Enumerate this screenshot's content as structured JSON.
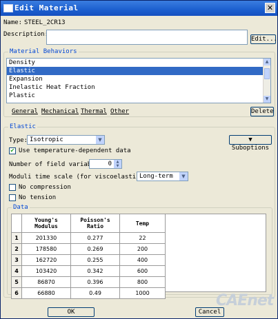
{
  "window": {
    "title": "Edit Material",
    "close_glyph": "✕"
  },
  "name": {
    "label": "Name:",
    "value": "STEEL_2CR13"
  },
  "description": {
    "label": "Description:",
    "value": "",
    "edit_label": "Edit..."
  },
  "behaviors": {
    "legend": "Material Behaviors",
    "items": [
      "Density",
      "Elastic",
      "Expansion",
      "Inelastic Heat Fraction",
      "Plastic"
    ],
    "selected": "Elastic",
    "menus": [
      "General",
      "Mechanical",
      "Thermal",
      "Other"
    ],
    "delete_label": "Delete"
  },
  "elastic": {
    "legend": "Elastic",
    "type_label": "Type:",
    "type_value": "Isotropic",
    "suboptions_label": "Suboptions",
    "use_temp_label": "Use temperature-dependent data",
    "use_temp_checked": true,
    "field_vars_label": "Number of field variables:",
    "field_vars_value": "0",
    "moduli_label": "Moduli time scale (for viscoelasticity):",
    "moduli_value": "Long-term",
    "no_compression_label": "No compression",
    "no_tension_label": "No tension"
  },
  "data": {
    "legend": "Data",
    "headers": [
      "Young's\nModulus",
      "Poisson's\nRatio",
      "Temp"
    ],
    "rows": [
      [
        "1",
        "201330",
        "0.277",
        "22"
      ],
      [
        "2",
        "178580",
        "0.269",
        "200"
      ],
      [
        "3",
        "162720",
        "0.255",
        "400"
      ],
      [
        "4",
        "103420",
        "0.342",
        "600"
      ],
      [
        "5",
        "86870",
        "0.396",
        "800"
      ],
      [
        "6",
        "66880",
        "0.49",
        "1000"
      ]
    ]
  },
  "footer": {
    "ok_label": "OK",
    "cancel_label": "Cancel"
  },
  "watermark": "CAEnet",
  "icons": {
    "check": "check-icon",
    "dropdown": "chevron-down-icon",
    "close": "close-icon"
  }
}
